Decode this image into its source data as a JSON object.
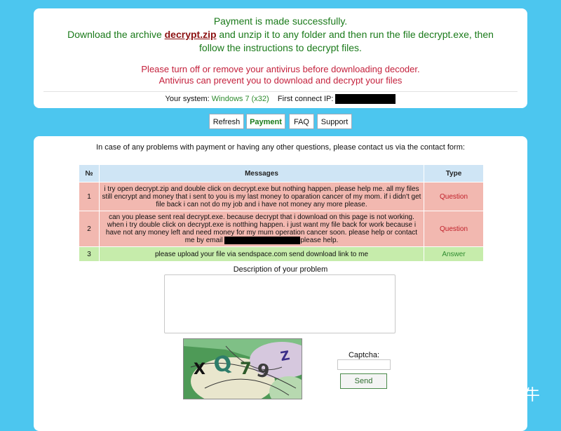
{
  "header": {
    "success_text": "Payment is made successfully.",
    "download_pre": "Download the archive ",
    "download_link": "decrypt.zip",
    "download_post": " and unzip it to any folder and then run the file decrypt.exe, then",
    "download_line2": "follow the instructions to decrypt files.",
    "antivirus_line1": "Please turn off or remove your antivirus before downloading decoder.",
    "antivirus_line2": "Antivirus can prevent you to download and decrypt your files",
    "system_label": "Your system: ",
    "system_value": "Windows 7 (x32)",
    "ip_label": "First connect IP:"
  },
  "nav": {
    "refresh": "Refresh",
    "payment": "Payment",
    "faq": "FAQ",
    "support": "Support",
    "active": "payment"
  },
  "support": {
    "contact_text": "In case of any problems with payment or having any other questions, please contact us via the contact form:",
    "table": {
      "headers": [
        "№",
        "Messages",
        "Type"
      ],
      "rows": [
        {
          "num": "1",
          "lines": [
            "i try open decrypt.zip and double click on decrypt.exe but nothing happen. please help me. all my files",
            "still encrypt and money that i sent to you is my last money to oparation cancer of my mom. if i didn't get",
            "file back i can not do my job and i have not money any more please."
          ],
          "type": "Question"
        },
        {
          "num": "2",
          "lines": [
            "can you please sent real decrypt.exe. because decrypt that i download on this page is not working.",
            "when i try double click on decrypt.exe is notthing happen. i just want my file back for work because i",
            "have not any money left and need money for my mum operation cancer soon. please help or contact"
          ],
          "line4_pre": "me by email ",
          "line4_post": "please help.",
          "type": "Question"
        },
        {
          "num": "3",
          "text": "please upload your file via sendspace.com send download link to me",
          "type": "Answer"
        }
      ]
    },
    "description_label": "Description of your problem",
    "description_value": "",
    "captcha_label": "Captcha:",
    "captcha_value": "",
    "captcha_glyphs": [
      "X",
      "Q",
      "7",
      "9",
      "Z"
    ],
    "send_label": "Send"
  },
  "watermark": {
    "icon": "wechat-icon",
    "text": "安全牛"
  },
  "colors": {
    "background": "#4cc6ef",
    "success_green": "#1a7a1a",
    "warning_red": "#c4213c",
    "link_red": "#8b1111",
    "question_bg": "#f2b8b0",
    "answer_bg": "#c6ecab",
    "header_bg": "#cfe5f5"
  }
}
